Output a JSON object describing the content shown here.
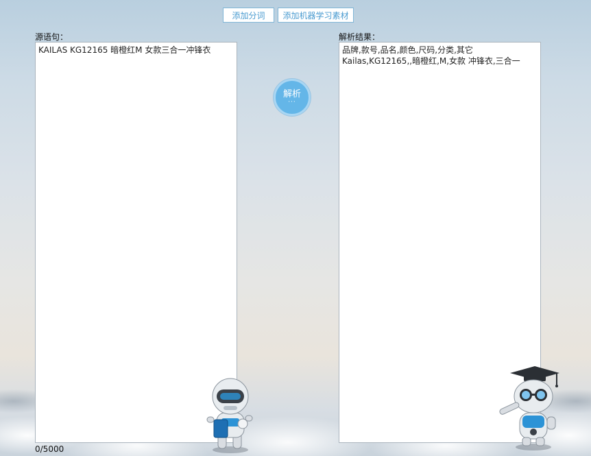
{
  "toolbar": {
    "add_segment_label": "添加分词",
    "add_ml_material_label": "添加机器学习素材"
  },
  "source": {
    "label": "源语句：",
    "text": "KAILAS KG12165 暗橙红M 女款三合一冲锋衣",
    "counter": "0/5000"
  },
  "parse_button": {
    "label": "解析",
    "dots": "···"
  },
  "result": {
    "label": "解析结果：",
    "text": "品牌,款号,品名,颜色,尺码,分类,其它\nKailas,KG12165,,暗橙红,M,女款 冲锋衣,三合一"
  },
  "colors": {
    "accent": "#64b6e8",
    "button_border": "#7fb5d6",
    "button_text": "#4a9bd0"
  },
  "icons": [
    "astronaut-robot-icon",
    "graduate-robot-icon"
  ]
}
